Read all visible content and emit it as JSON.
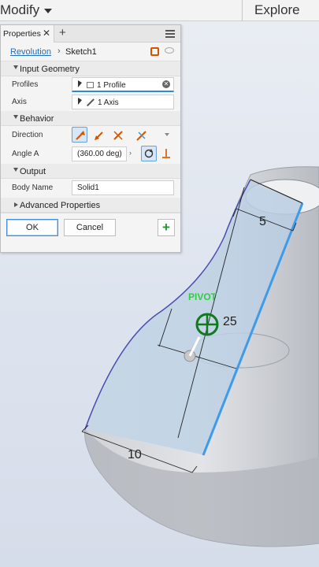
{
  "ribbon": {
    "modify_label": "Modify",
    "explore_label": "Explore"
  },
  "panel": {
    "tab_label": "Properties",
    "command": "Revolution",
    "sketch": "Sketch1",
    "sections": {
      "input_geometry": "Input Geometry",
      "behavior": "Behavior",
      "output": "Output",
      "advanced": "Advanced Properties"
    },
    "profiles": {
      "label": "Profiles",
      "value": "1 Profile"
    },
    "axis": {
      "label": "Axis",
      "value": "1 Axis"
    },
    "direction": {
      "label": "Direction"
    },
    "angle": {
      "label": "Angle A",
      "value": "(360.00 deg)"
    },
    "body_name": {
      "label": "Body Name",
      "value": "Solid1"
    },
    "ok_label": "OK",
    "cancel_label": "Cancel"
  },
  "viewport": {
    "dim_top": "5",
    "dim_mid": "25",
    "dim_bottom": "10",
    "pivot_label": "PIVOT"
  },
  "colors": {
    "accent": "#2f88d8",
    "profile_edge": "#3d9be9",
    "pivot": "#2ad13a",
    "ok": "#1a9a2a"
  }
}
